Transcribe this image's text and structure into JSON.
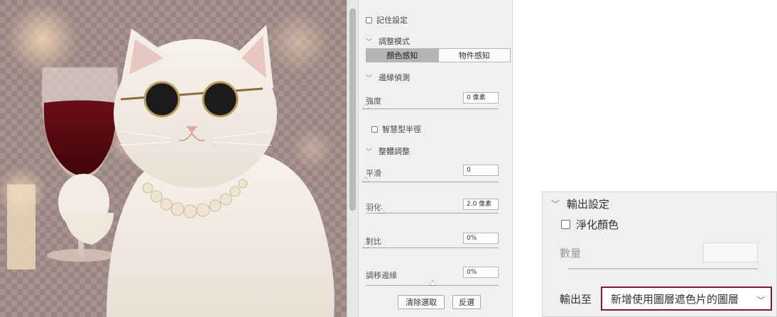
{
  "panel": {
    "remember_settings": "記住設定",
    "adjust_mode": {
      "title": "調整模式",
      "options": [
        "顏色感知",
        "物件感知"
      ],
      "selected": "顏色感知"
    },
    "edge_detection": {
      "title": "邊緣偵測",
      "strength_label": "強度",
      "strength_value": "0 像素",
      "strength_level": 0,
      "smart_radius": "智慧型半徑"
    },
    "global_refinements": {
      "title": "整體調整",
      "smooth_label": "平滑",
      "smooth_value": "0",
      "smooth_level": 0,
      "feather_label": "羽化",
      "feather_value": "2.0 像素",
      "feather_level": 0.12,
      "contrast_label": "對比",
      "contrast_value": "0%",
      "contrast_level": 0,
      "shift_edge_label": "調移邊緣",
      "shift_edge_value": "0%",
      "shift_edge_level": 0.5
    },
    "clear_selection": "清除選取",
    "invert": "反選"
  },
  "output": {
    "title": "輸出設定",
    "decontaminate": "淨化顏色",
    "amount_label": "數量",
    "output_to_label": "輸出至",
    "output_to_value": "新增使用圖層遮色片的圖層"
  },
  "colors": {
    "highlight_border": "#7d1b2d",
    "segment_active": "#b4b4b4"
  }
}
